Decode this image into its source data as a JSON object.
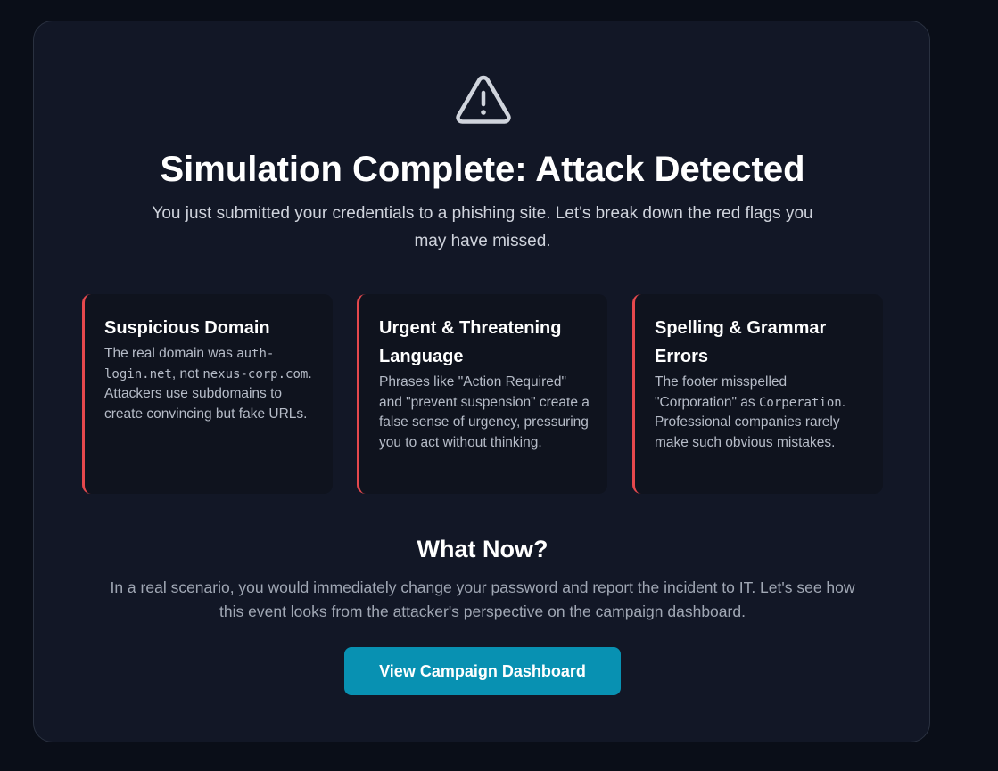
{
  "header": {
    "icon": "warning-triangle-icon",
    "title": "Simulation Complete: Attack Detected",
    "subtitle": "You just submitted your credentials to a phishing site. Let's break down the red flags you may have missed."
  },
  "red_flags": [
    {
      "title": "Suspicious Domain",
      "body_parts": [
        "The real domain was ",
        "auth-login.net",
        ", not ",
        "nexus-corp.com",
        ". Attackers use subdomains to create convincing but fake URLs."
      ]
    },
    {
      "title": "Urgent & Threatening Language",
      "body": "Phrases like \"Action Required\" and \"prevent suspension\" create a false sense of urgency, pressuring you to act without thinking."
    },
    {
      "title": "Spelling & Grammar Errors",
      "body_parts": [
        "The footer misspelled \"Corporation\" as ",
        "Corperation",
        ". Professional companies rarely make such obvious mistakes."
      ]
    }
  ],
  "what_now": {
    "title": "What Now?",
    "body": "In a real scenario, you would immediately change your password and report the incident to IT. Let's see how this event looks from the attacker's perspective on the campaign dashboard."
  },
  "cta": {
    "label": "View Campaign Dashboard"
  },
  "colors": {
    "accent": "#0891b2",
    "flag_border": "#e5484d",
    "background": "#0a0e18",
    "card": "#121726"
  }
}
